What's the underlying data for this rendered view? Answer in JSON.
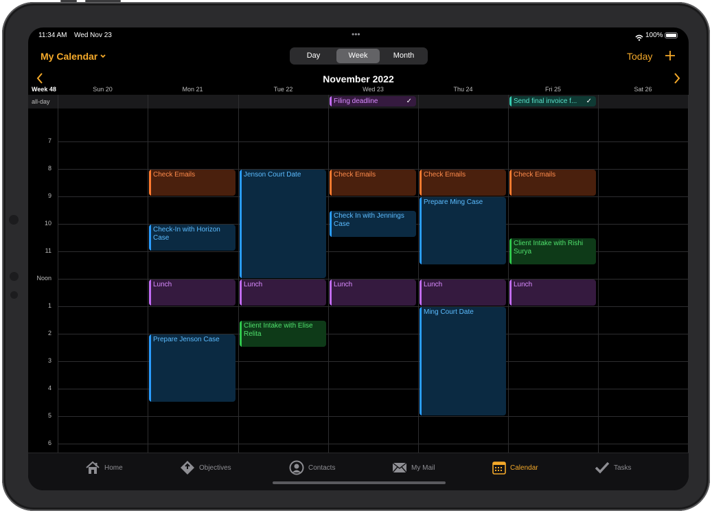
{
  "status": {
    "time": "11:34 AM",
    "date": "Wed Nov 23",
    "dots": "•••",
    "battery": "100%"
  },
  "colors": {
    "accent": "#f4a92a",
    "orange": "#ff7a2e",
    "blue": "#2a9dff",
    "purple": "#c26cf5",
    "green": "#2fc84c",
    "teal": "#36c9b0"
  },
  "header": {
    "calendar_title": "My Calendar",
    "views": [
      "Day",
      "Week",
      "Month"
    ],
    "active_view": "Week",
    "today_label": "Today",
    "add_icon": "plus-icon",
    "month_title": "November 2022",
    "prev_icon": "chevron-left-icon",
    "next_icon": "chevron-right-icon"
  },
  "week": {
    "label": "Week 48",
    "days": [
      "Sun 20",
      "Mon 21",
      "Tue 22",
      "Wed 23",
      "Thu 24",
      "Fri 25",
      "Sat 26"
    ],
    "allday_label": "all-day"
  },
  "hours": [
    "7",
    "8",
    "9",
    "10",
    "11",
    "Noon",
    "1",
    "2",
    "3",
    "4",
    "5",
    "6"
  ],
  "allday_events": [
    {
      "title": "Filing deadline",
      "day": 3,
      "color": "purple",
      "done": true,
      "check": "✓"
    },
    {
      "title": "Send final invoice f...",
      "day": 5,
      "color": "teal",
      "done": true,
      "check": "✓"
    }
  ],
  "events": [
    {
      "title": "Check Emails",
      "day": 1,
      "start": 8,
      "end": 9,
      "color": "orange"
    },
    {
      "title": "Check-In with Horizon Case",
      "day": 1,
      "start": 10,
      "end": 11,
      "color": "blue"
    },
    {
      "title": "Lunch",
      "day": 1,
      "start": 12,
      "end": 13,
      "color": "purple"
    },
    {
      "title": "Prepare Jenson Case",
      "day": 1,
      "start": 14,
      "end": 16.5,
      "color": "blue"
    },
    {
      "title": "Jenson Court Date",
      "day": 2,
      "start": 8,
      "end": 12,
      "color": "blue"
    },
    {
      "title": "Lunch",
      "day": 2,
      "start": 12,
      "end": 13,
      "color": "purple"
    },
    {
      "title": "Client Intake with Elise Relita",
      "day": 2,
      "start": 13.5,
      "end": 14.5,
      "color": "green"
    },
    {
      "title": "Check Emails",
      "day": 3,
      "start": 8,
      "end": 9,
      "color": "orange"
    },
    {
      "title": "Check In with Jennings Case",
      "day": 3,
      "start": 9.5,
      "end": 10.5,
      "color": "blue"
    },
    {
      "title": "Lunch",
      "day": 3,
      "start": 12,
      "end": 13,
      "color": "purple"
    },
    {
      "title": "Check Emails",
      "day": 4,
      "start": 8,
      "end": 9,
      "color": "orange"
    },
    {
      "title": "Prepare Ming Case",
      "day": 4,
      "start": 9,
      "end": 11.5,
      "color": "blue"
    },
    {
      "title": "Lunch",
      "day": 4,
      "start": 12,
      "end": 13,
      "color": "purple"
    },
    {
      "title": "Ming Court Date",
      "day": 4,
      "start": 13,
      "end": 17,
      "color": "blue"
    },
    {
      "title": "Check Emails",
      "day": 5,
      "start": 8,
      "end": 9,
      "color": "orange"
    },
    {
      "title": "Client Intake with Rishi Surya",
      "day": 5,
      "start": 10.5,
      "end": 11.5,
      "color": "green"
    },
    {
      "title": "Lunch",
      "day": 5,
      "start": 12,
      "end": 13,
      "color": "purple"
    }
  ],
  "tabs": [
    {
      "label": "Home",
      "icon": "home-icon"
    },
    {
      "label": "Objectives",
      "icon": "objectives-icon"
    },
    {
      "label": "Contacts",
      "icon": "contacts-icon"
    },
    {
      "label": "My Mail",
      "icon": "mail-icon"
    },
    {
      "label": "Calendar",
      "icon": "calendar-icon",
      "active": true
    },
    {
      "label": "Tasks",
      "icon": "checkmark-icon"
    }
  ]
}
